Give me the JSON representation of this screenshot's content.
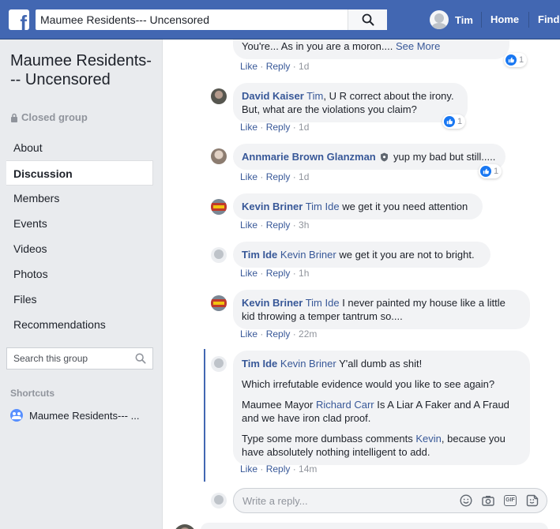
{
  "topbar": {
    "search_value": "Maumee Residents--- Uncensored",
    "user_name": "Tim",
    "nav_home": "Home",
    "nav_find": "Find"
  },
  "sidebar": {
    "group_name": "Maumee Residents--- Uncensored",
    "group_type": "Closed group",
    "items": [
      {
        "label": "About"
      },
      {
        "label": "Discussion",
        "active": true
      },
      {
        "label": "Members"
      },
      {
        "label": "Events"
      },
      {
        "label": "Videos"
      },
      {
        "label": "Photos"
      },
      {
        "label": "Files"
      },
      {
        "label": "Recommendations"
      }
    ],
    "search_placeholder": "Search this group",
    "shortcuts_label": "Shortcuts",
    "shortcut_item": "Maumee Residents--- ..."
  },
  "comments": [
    {
      "text": "You're... As in you are a moron....",
      "see_more": "See More",
      "like": "Like",
      "reply": "Reply",
      "time": "1d",
      "reactions": "1"
    },
    {
      "author": "David Kaiser",
      "mention": "Tim",
      "text_line1": ", U R correct about the irony.",
      "text_line2": "But, what are the violations you claim?",
      "like": "Like",
      "reply": "Reply",
      "time": "1d",
      "reactions": "1"
    },
    {
      "author": "Annmarie Brown Glanzman",
      "text": "yup my bad but still.....",
      "like": "Like",
      "reply": "Reply",
      "time": "1d",
      "reactions": "1"
    },
    {
      "author": "Kevin Briner",
      "mention": "Tim Ide",
      "text": "we get it you need attention",
      "like": "Like",
      "reply": "Reply",
      "time": "3h"
    },
    {
      "author": "Tim Ide",
      "mention": "Kevin Briner",
      "text": "we get it you are not to bright.",
      "like": "Like",
      "reply": "Reply",
      "time": "1h"
    },
    {
      "author": "Kevin Briner",
      "mention": "Tim Ide",
      "text_line1": "I never painted my house like a little",
      "text_line2": "kid throwing a temper tantrum so....",
      "like": "Like",
      "reply": "Reply",
      "time": "22m"
    },
    {
      "author": "Tim Ide",
      "mention": "Kevin Briner",
      "text": "Y'all dumb as shit!",
      "para2": "Which irrefutable evidence would you like to see again?",
      "para3_a": "Maumee Mayor",
      "para3_mention": "Richard Carr",
      "para3_b": "Is A Liar A Faker and A Fraud",
      "para3_line2": "and we have iron clad proof.",
      "para4_a": "Type some more dumbass comments",
      "para4_mention": "Kevin",
      "para4_b": ", because you",
      "para4_line2": "have absolutely nothing intelligent to add.",
      "like": "Like",
      "reply": "Reply",
      "time": "14m"
    }
  ],
  "reply_box": {
    "placeholder": "Write a reply..."
  },
  "icons": {
    "gif_label": "GIF"
  },
  "colors": {
    "brand": "#4267b2",
    "link": "#385898",
    "like_blue": "#1877f2"
  }
}
